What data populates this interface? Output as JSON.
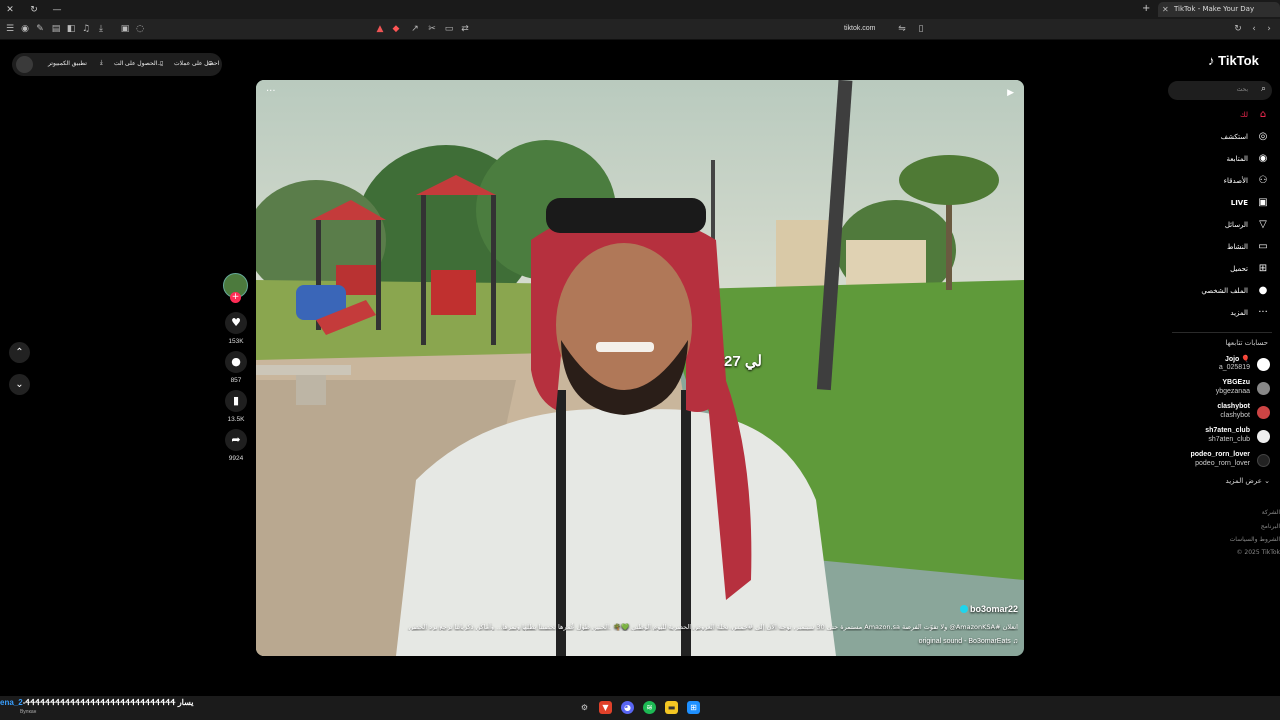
{
  "browser": {
    "tab_title": "TikTok - Make Your Day",
    "url": "tiktok.com"
  },
  "topbar": {
    "get_coins": "احصل على عملات",
    "get_app": "الحصول على الت...",
    "desktop_app": "تطبيق الكمبيوتر"
  },
  "video": {
    "overlay_text": "لي 27",
    "author": "bo3omar22",
    "caption": "انعلان #AmazonKSA@ ولا تفوّت الفرصة Amazon.sa مستمرة حتى 30 سبتمبر، توجه الآن إلى #خمس_نخلة العروض الحصرية لليوم الوطني 💚🌴 .الحنين طول عُمرها تحضننا بظلها وتمرها... وأماكن ذكرياتنا ترجع نرد الحضن",
    "sound": "original sound - Bo3omarEats"
  },
  "actions": {
    "likes": "153K",
    "comments": "857",
    "saves": "13.5K",
    "shares": "9924"
  },
  "sidebar": {
    "logo": "TikTok",
    "search_placeholder": "بحث",
    "nav": [
      {
        "label": "لك",
        "icon": "home-icon"
      },
      {
        "label": "استكشف",
        "icon": "compass-icon"
      },
      {
        "label": "المتابعة",
        "icon": "following-icon"
      },
      {
        "label": "الأصدقاء",
        "icon": "friends-icon"
      },
      {
        "label": "LIVE",
        "icon": "live-icon"
      },
      {
        "label": "الرسائل",
        "icon": "messages-icon"
      },
      {
        "label": "النشاط",
        "icon": "activity-icon"
      },
      {
        "label": "تحميل",
        "icon": "upload-icon"
      },
      {
        "label": "الملف الشخصي",
        "icon": "profile-icon"
      },
      {
        "label": "المزيد",
        "icon": "more-icon"
      }
    ],
    "following_title": "حسابات تتابعها",
    "accounts": [
      {
        "name": "Jojo 🎈",
        "handle": "a_025819",
        "color": "#ffffff"
      },
      {
        "name": "YBGEzu",
        "handle": "ybgezanaa",
        "color": "#888888"
      },
      {
        "name": "clashybot",
        "handle": "clashybot",
        "color": "#c44"
      },
      {
        "name": "sh7aten_club",
        "handle": "sh7aten_club",
        "color": "#eeeeee"
      },
      {
        "name": "podeo_rorn_lover",
        "handle": "podeo_rorn_lover",
        "color": "#222222"
      }
    ],
    "see_more": "عرض المزيد",
    "footer": [
      "الشركة",
      "البرنامج",
      "الشروط والسياسات",
      "© 2025 TikTok"
    ]
  },
  "taskbar": {
    "prefix": "ena_2",
    "text": "-ᏎᏎᏎᏎᏎᏎᏎᏎᏎᏎᏎᏎᏎᏎᏎᏎᏎᏎᏎᏎᏎᏎᏎᏎᏎᏎᏎᏎᏎᏎ يسار",
    "sub": "Вулкан"
  }
}
